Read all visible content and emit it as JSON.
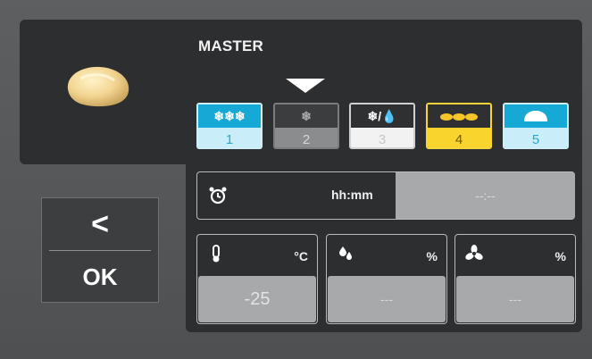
{
  "program": {
    "title": "MASTER"
  },
  "phases": [
    {
      "label": "1",
      "icon": "snowflake-triple-icon",
      "symbol": "❄❄❄",
      "state": "active"
    },
    {
      "label": "2",
      "icon": "snowflake-icon",
      "symbol": "❄",
      "state": "selected"
    },
    {
      "label": "3",
      "icon": "snowflake-humidity-icon",
      "symbol": "❄/💧",
      "state": "active"
    },
    {
      "label": "4",
      "icon": "bread-rising-icon",
      "symbol": "▬▬▬",
      "state": "current"
    },
    {
      "label": "5",
      "icon": "bread-loaf-icon",
      "symbol": "⌓",
      "state": "active"
    }
  ],
  "navigation": {
    "back_label": "<",
    "ok_label": "OK"
  },
  "time": {
    "icon": "alarm-clock-icon",
    "unit": "hh:mm",
    "value": "--:--"
  },
  "parameters": [
    {
      "name": "temperature",
      "icon": "thermometer-icon",
      "unit": "°C",
      "value": "-25"
    },
    {
      "name": "humidity",
      "icon": "water-drops-icon",
      "unit": "%",
      "value": "---"
    },
    {
      "name": "fan",
      "icon": "fan-icon",
      "unit": "%",
      "value": "---"
    }
  ],
  "colors": {
    "accent_blue": "#17a9d6",
    "accent_yellow": "#f8d42c",
    "panel": "#2c2e30"
  }
}
